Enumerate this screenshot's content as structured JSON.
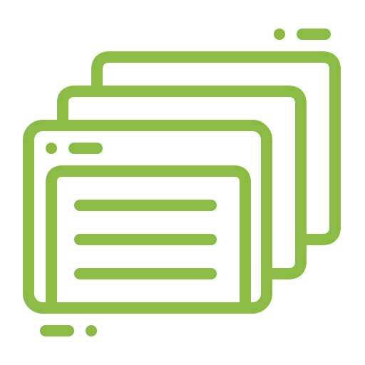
{
  "icon": {
    "name": "stacked-browser-windows-icon",
    "style": "outline",
    "stroke_color": "#8BBB45",
    "background_color": "#FFFFFF",
    "window_count": 3,
    "content_lines": 3
  }
}
